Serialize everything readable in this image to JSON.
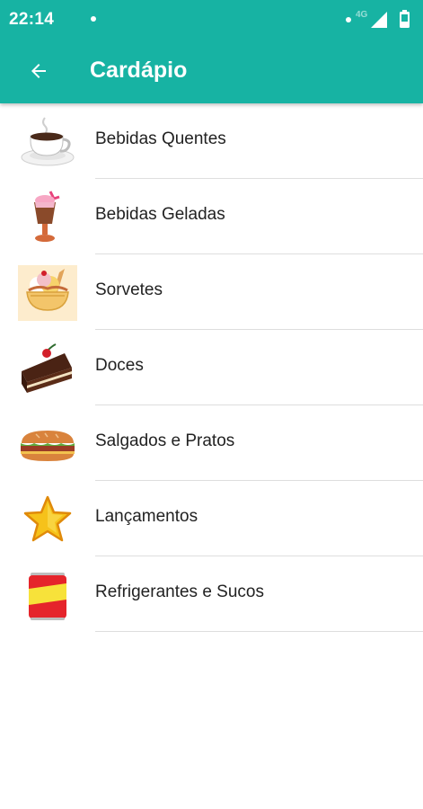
{
  "status_bar": {
    "time": "22:14",
    "network": "4G",
    "icons": [
      "notification-dot-icon",
      "signal-icon",
      "battery-icon"
    ]
  },
  "app_bar": {
    "title": "Cardápio",
    "back_icon": "arrow-back-icon",
    "color": "#17b3a3"
  },
  "menu": {
    "items": [
      {
        "label": "Bebidas Quentes",
        "icon": "hot-coffee-icon"
      },
      {
        "label": "Bebidas Geladas",
        "icon": "milkshake-icon"
      },
      {
        "label": "Sorvetes",
        "icon": "ice-cream-sundae-icon"
      },
      {
        "label": "Doces",
        "icon": "cake-slice-icon"
      },
      {
        "label": "Salgados e Pratos",
        "icon": "sandwich-icon"
      },
      {
        "label": "Lançamentos",
        "icon": "star-icon"
      },
      {
        "label": "Refrigerantes e Sucos",
        "icon": "soda-can-icon"
      }
    ]
  }
}
